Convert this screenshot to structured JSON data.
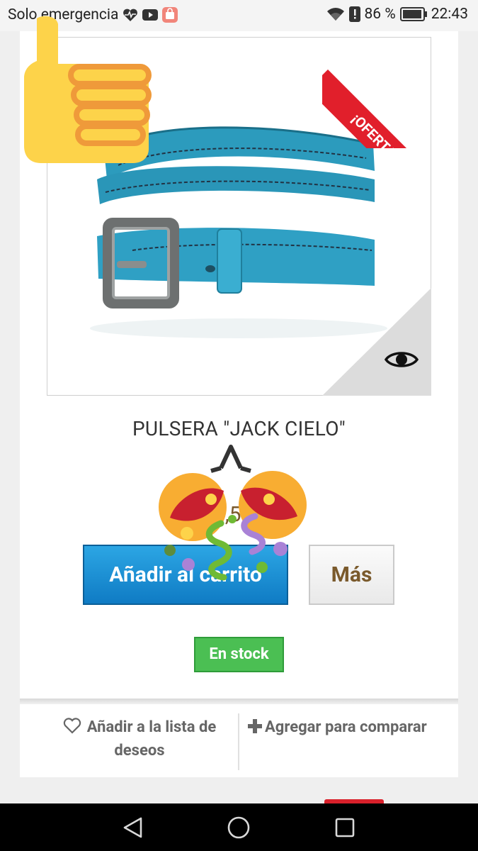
{
  "status_bar": {
    "carrier": "Solo emergencia",
    "battery": "86 %",
    "time": "22:43"
  },
  "product": {
    "ribbon": "¡OFERTA!",
    "title": "PULSERA \"JACK CIELO\"",
    "price_visible": ",50",
    "add_to_cart": "Añadir al carrito",
    "more": "Más",
    "stock": "En stock"
  },
  "actions": {
    "wishlist": "Añadir a la lista de deseos",
    "compare": "Agregar para comparar"
  },
  "colors": {
    "ribbon": "#e11f2b",
    "cart_button": "#1a8fd6",
    "stock_badge": "#4bbf53",
    "price": "#7a5a2c"
  },
  "icons": [
    "heart-pulse-icon",
    "youtube-icon",
    "shopping-bag-icon",
    "wifi-icon",
    "alert-icon",
    "battery-icon",
    "eye-icon",
    "heart-icon",
    "plus-icon",
    "back-icon",
    "home-icon",
    "recents-icon",
    "thumbs-up-emoji",
    "party-popper-emoji"
  ]
}
